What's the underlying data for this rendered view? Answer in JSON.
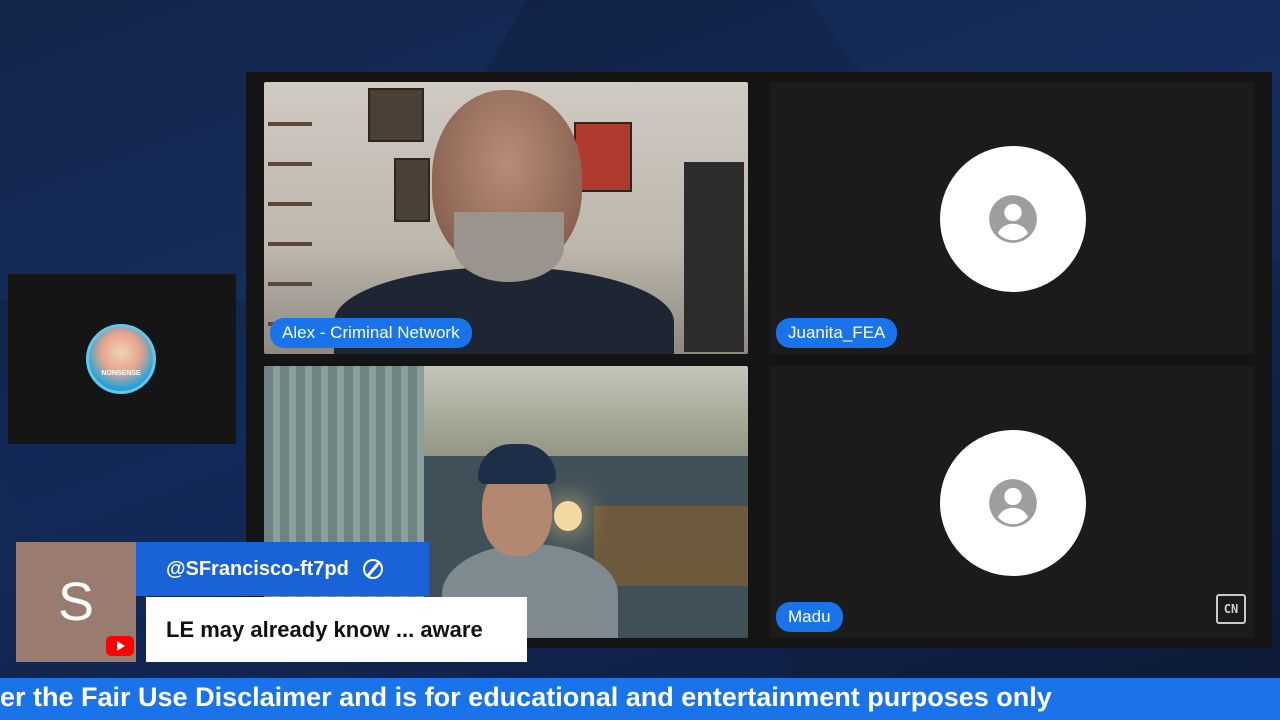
{
  "participants": [
    {
      "name": "Alex - Criminal Network",
      "video": true
    },
    {
      "name": "Juanita_FEA",
      "video": false
    },
    {
      "name": "",
      "video": true
    },
    {
      "name": "Madu",
      "video": false
    }
  ],
  "side_panel": {
    "avatar_text": "NONSENSE"
  },
  "chat": {
    "avatar_letter": "S",
    "username": "@SFrancisco-ft7pd",
    "message": "LE may already know ... aware"
  },
  "ticker": {
    "text": "er the Fair Use Disclaimer and is for educational and entertainment purposes only"
  },
  "corner_logo": "CN",
  "colors": {
    "accent": "#1a73e8",
    "chat_header": "#1a62d8",
    "tile_bg": "#1b1b1b",
    "stage_bg": "#141414"
  }
}
